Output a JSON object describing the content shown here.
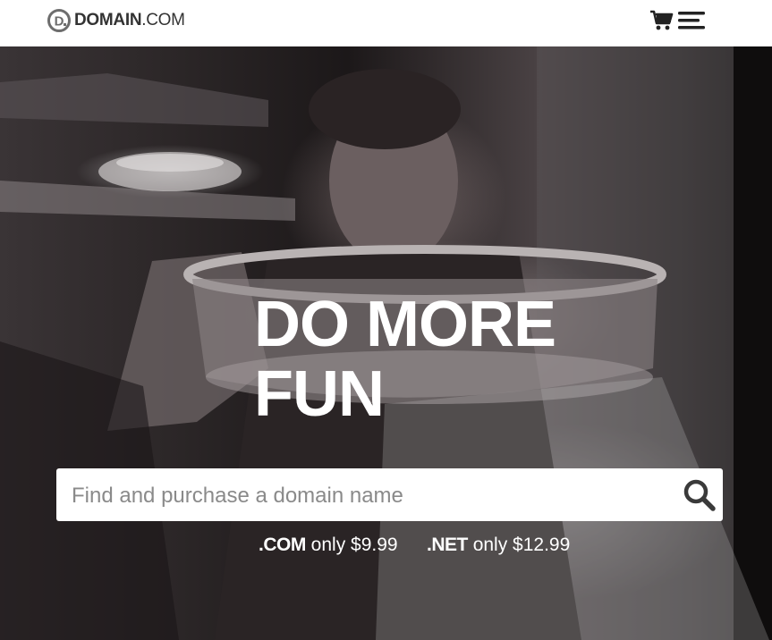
{
  "header": {
    "logo": {
      "bold": "DOMAIN",
      "light": ".COM"
    },
    "icons": {
      "cart": "cart-icon",
      "menu": "menu-icon",
      "logo_mark": "domain-d-logo-icon"
    },
    "colors": {
      "logo_gray": "#6d6d6d",
      "icon_dark": "#222222"
    }
  },
  "hero": {
    "headline_line1": "DO MORE",
    "headline_line2": "FUN",
    "search": {
      "placeholder": "Find and purchase a domain name",
      "value": "",
      "icon": "search-icon"
    },
    "pricing": [
      {
        "tld": ".COM",
        "text": "only $9.99"
      },
      {
        "tld": ".NET",
        "text": "only $12.99"
      }
    ]
  }
}
